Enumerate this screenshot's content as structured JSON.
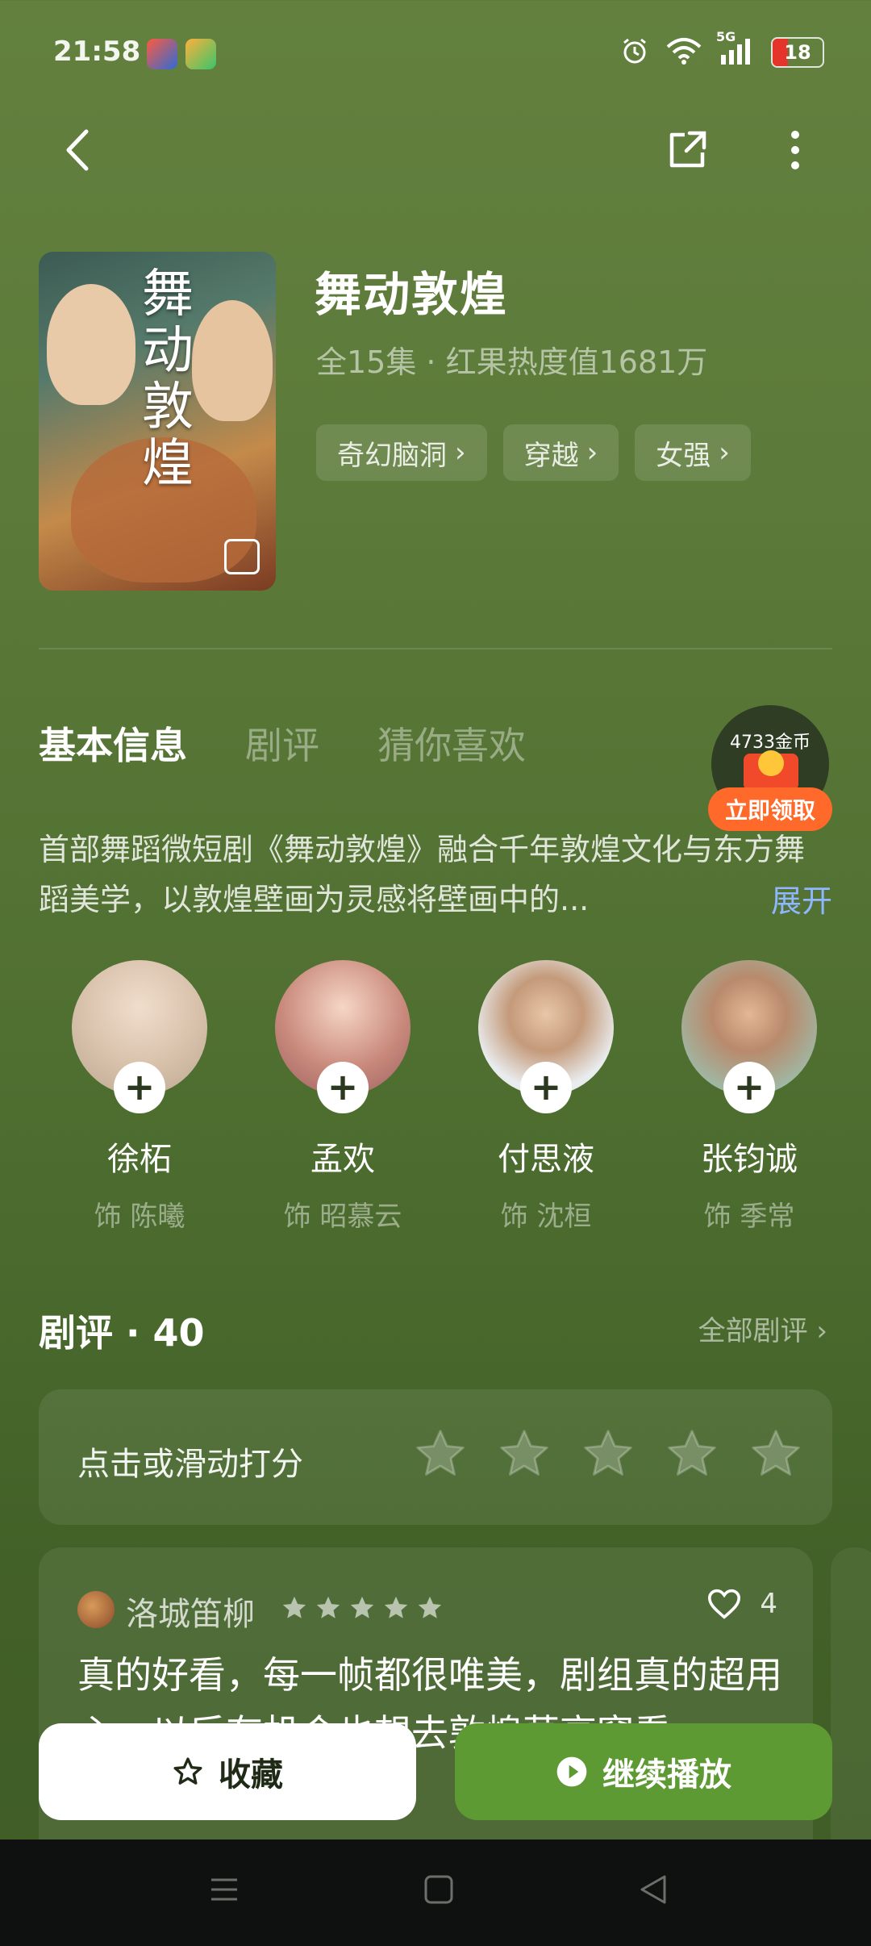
{
  "status_bar": {
    "time": "21:58",
    "network": "5G",
    "battery": "18"
  },
  "show": {
    "title": "舞动敦煌",
    "meta": "全15集 · 红果热度值1681万",
    "poster_title": "舞动敦煌",
    "tags": [
      "奇幻脑洞",
      "穿越",
      "女强"
    ]
  },
  "tabs": [
    "基本信息",
    "剧评",
    "猜你喜欢"
  ],
  "coin_badge": {
    "amount": "4733金币",
    "action": "立即领取"
  },
  "description": {
    "text": "首部舞蹈微短剧《舞动敦煌》融合千年敦煌文化与东方舞蹈美学，以敦煌壁画为灵感将壁画中的...",
    "expand": "展开"
  },
  "cast": [
    {
      "name": "徐柘",
      "role": "饰 陈曦"
    },
    {
      "name": "孟欢",
      "role": "饰 昭慕云"
    },
    {
      "name": "付思液",
      "role": "饰 沈桓"
    },
    {
      "name": "张钧诚",
      "role": "饰 季常"
    }
  ],
  "reviews": {
    "title": "剧评 · 40",
    "all_link": "全部剧评",
    "rate_prompt": "点击或滑动打分",
    "items": [
      {
        "user": "洛城笛柳",
        "likes": "4",
        "text": "真的好看，每一帧都很唯美，剧组真的超用心，以后有机会也想去敦煌莫高窟看..."
      }
    ]
  },
  "actions": {
    "favorite": "收藏",
    "play": "继续播放"
  },
  "colors": {
    "background": "#5a7a38",
    "accent_play": "#5e9a34",
    "coin_button": "#ff6a2b",
    "expand_link": "#8fb7ff"
  },
  "icons": [
    "back-icon",
    "share-icon",
    "more-icon",
    "alarm-icon",
    "wifi-icon",
    "signal-icon",
    "star-icon",
    "heart-icon",
    "play-icon",
    "home-icon",
    "menu-icon",
    "nav-back-icon"
  ]
}
